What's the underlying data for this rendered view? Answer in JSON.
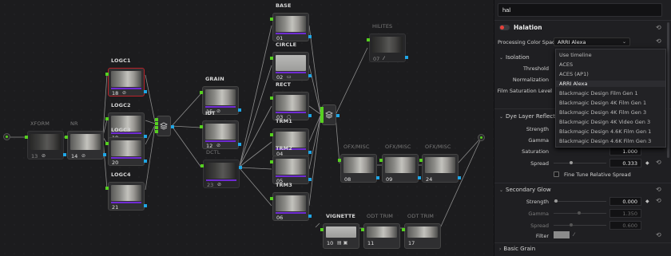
{
  "graph": {
    "nodes": {
      "xform": {
        "label": "XFORM",
        "num": "13"
      },
      "nr": {
        "label": "NR",
        "num": "14"
      },
      "logc1": {
        "label": "LOGC1",
        "num": "18"
      },
      "logc2": {
        "label": "LOGC2",
        "num": "19"
      },
      "logc3": {
        "label": "LOGC3",
        "num": "20"
      },
      "logc4": {
        "label": "LOGC4",
        "num": "21"
      },
      "grain": {
        "label": "GRAIN",
        "num": "15"
      },
      "idt": {
        "label": "IDT",
        "num": "12"
      },
      "dctl": {
        "label": "DCTL",
        "num": "23"
      },
      "base": {
        "label": "BASE",
        "num": "01"
      },
      "circle": {
        "label": "CIRCLE",
        "num": "02"
      },
      "rect": {
        "label": "RECT",
        "num": "03"
      },
      "trm1": {
        "label": "TRM1",
        "num": "04"
      },
      "trm2": {
        "label": "TRM2",
        "num": "05"
      },
      "trm3": {
        "label": "TRM3",
        "num": "06"
      },
      "hilites": {
        "label": "HILITES",
        "num": "07"
      },
      "ofx1": {
        "label": "OFX/MISC",
        "num": "08"
      },
      "ofx2": {
        "label": "OFX/MISC",
        "num": "09"
      },
      "ofx3": {
        "label": "OFX/MISC",
        "num": "24"
      },
      "vignette": {
        "label": "VIGNETTE",
        "num": "10"
      },
      "odt1": {
        "label": "ODT TRIM",
        "num": "11"
      },
      "odt2": {
        "label": "ODT TRIM",
        "num": "17"
      }
    },
    "icons": {
      "fx": "fx-icon",
      "circle": "circle-window-icon",
      "link": "link-icon",
      "filter": "filter-icon"
    }
  },
  "panel": {
    "search": {
      "value": "hal"
    },
    "effect_title": "Halation",
    "processing_color_space": {
      "label": "Processing Color Space",
      "value": "ARRI Alexa"
    },
    "menu": {
      "options": [
        "Use timeline",
        "ACES",
        "ACES (AP1)",
        "ARRI Alexa",
        "Blackmagic Design Film Gen 1",
        "Blackmagic Design 4K Film Gen 1",
        "Blackmagic Design 4K Film Gen 3",
        "Blackmagic Design 4K Video Gen 3",
        "Blackmagic Design 4.6K Film Gen 1",
        "Blackmagic Design 4.6K Film Gen 3"
      ],
      "selected": "ARRI Alexa"
    },
    "isolation": {
      "title": "Isolation",
      "threshold_label": "Threshold",
      "normalization_label": "Normalization",
      "film_saturation_label": "Film Saturation Level"
    },
    "dye_layer": {
      "title": "Dye Layer Reflection",
      "strength_label": "Strength",
      "gamma_label": "Gamma",
      "saturation_label": "Saturation",
      "saturation_value": "1.000",
      "spread_label": "Spread",
      "spread_value": "0.333",
      "spread_fraction": 0.33,
      "fine_tune_label": "Fine Tune Relative Spread"
    },
    "secondary_glow": {
      "title": "Secondary Glow",
      "strength_label": "Strength",
      "strength_value": "0.000",
      "gamma_label": "Gamma",
      "gamma_value": "1.350",
      "spread_label": "Spread",
      "spread_value": "0.600",
      "filter_label": "Filter"
    },
    "basic_grain": {
      "title": "Basic Grain"
    },
    "colors": {
      "accent_red": "#e8413b",
      "node_in": "#56d020",
      "node_out": "#1fa6e6",
      "selected_border": "#b8232a"
    }
  }
}
